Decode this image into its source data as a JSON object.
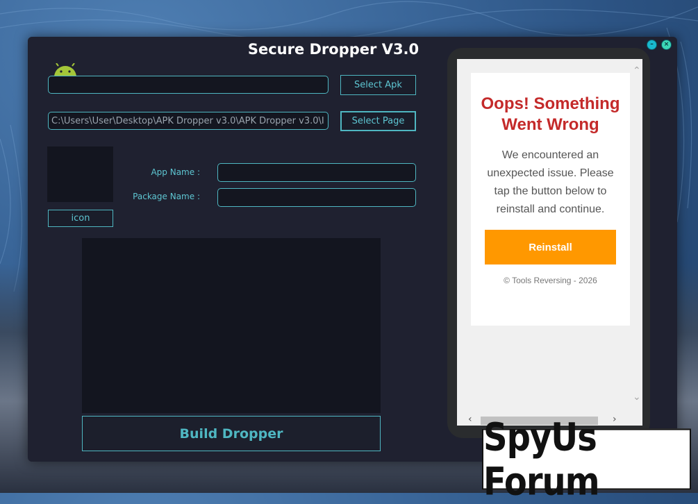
{
  "app": {
    "title": "Secure Dropper V3.0"
  },
  "window_controls": {
    "minimize_glyph": "–",
    "close_glyph": "×"
  },
  "apk": {
    "path_value": "",
    "select_label": "Select Apk"
  },
  "page": {
    "path_value": "C:\\Users\\User\\Desktop\\APK Dropper v3.0\\APK Dropper v3.0\\I",
    "select_label": "Select Page"
  },
  "icon": {
    "button_label": "icon"
  },
  "form": {
    "app_name_label": "App Name :",
    "app_name_value": "",
    "package_name_label": "Package Name :",
    "package_name_value": ""
  },
  "build": {
    "label": "Build Dropper"
  },
  "preview": {
    "heading": "Oops! Something Went Wrong",
    "message": "We encountered an unexpected issue. Please tap the button below to reinstall and continue.",
    "button_label": "Reinstall",
    "footer": "© Tools Reversing - 2026"
  },
  "watermark": {
    "text": "SpyUs Forum"
  },
  "colors": {
    "accent": "#4fb7c2",
    "window_bg": "#1f2130",
    "error_red": "#c42a2a",
    "reinstall_orange": "#ff9800"
  }
}
